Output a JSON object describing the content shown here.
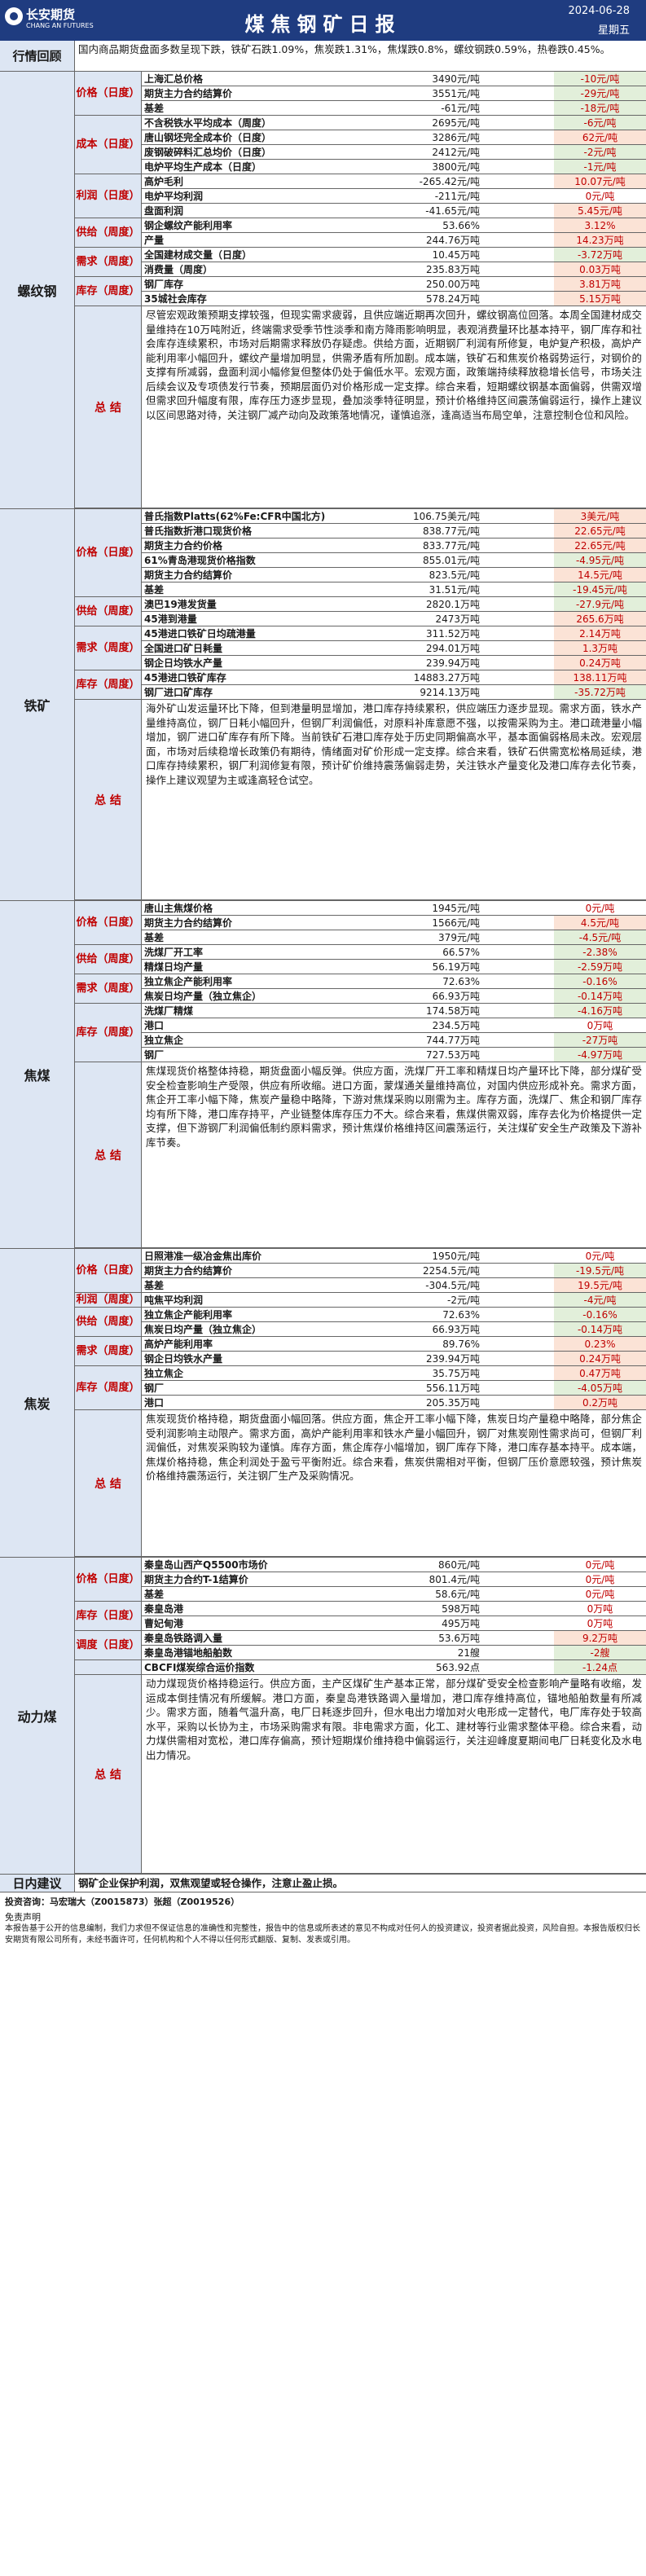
{
  "header": {
    "logo_cn": "长安期货",
    "logo_en": "CHANG AN FUTURES",
    "title": "煤焦钢矿日报",
    "date": "2024-06-28",
    "weekday": "星期五"
  },
  "review": {
    "label": "行情回顾",
    "text": "国内商品期货盘面多数呈现下跌，铁矿石跌1.09%，焦炭跌1.31%，焦煤跌0.8%，螺纹钢跌0.59%，热卷跌0.45%。"
  },
  "sections": [
    {
      "name": "螺纹钢",
      "groups": [
        {
          "label": "价格（日度）",
          "rows": [
            {
              "k": "上海汇总价格",
              "v": "3490元/吨",
              "c": "-10元/吨",
              "s": "dn"
            },
            {
              "k": "期货主力合约结算价",
              "v": "3551元/吨",
              "c": "-29元/吨",
              "s": "dn"
            },
            {
              "k": "基差",
              "v": "-61元/吨",
              "c": "-18元/吨",
              "s": "dn"
            }
          ]
        },
        {
          "label": "成本（日度）",
          "rows": [
            {
              "k": "不含税铁水平均成本（周度）",
              "v": "2695元/吨",
              "c": "-6元/吨",
              "s": "dn"
            },
            {
              "k": "唐山钢坯完全成本价（日度）",
              "v": "3286元/吨",
              "c": "62元/吨",
              "s": "up"
            },
            {
              "k": "废钢破碎料汇总均价（日度）",
              "v": "2412元/吨",
              "c": "-2元/吨",
              "s": "dn"
            },
            {
              "k": "电炉平均生产成本（日度）",
              "v": "3800元/吨",
              "c": "-1元/吨",
              "s": "dn"
            }
          ]
        },
        {
          "label": "利润（日度）",
          "rows": [
            {
              "k": "高炉毛利",
              "v": "-265.42元/吨",
              "c": "10.07元/吨",
              "s": "up"
            },
            {
              "k": "电炉平均利润",
              "v": "-211元/吨",
              "c": "0元/吨",
              "s": ""
            },
            {
              "k": "盘面利润",
              "v": "-41.65元/吨",
              "c": "5.45元/吨",
              "s": "up"
            }
          ]
        },
        {
          "label": "供给（周度）",
          "rows": [
            {
              "k": "钢企螺纹产能利用率",
              "v": "53.66%",
              "c": "3.12%",
              "s": "up"
            },
            {
              "k": "产量",
              "v": "244.76万吨",
              "c": "14.23万吨",
              "s": "up"
            }
          ]
        },
        {
          "label": "需求（周度）",
          "rows": [
            {
              "k": "全国建材成交量（日度）",
              "v": "10.45万吨",
              "c": "-3.72万吨",
              "s": "dn"
            },
            {
              "k": "消费量（周度）",
              "v": "235.83万吨",
              "c": "0.03万吨",
              "s": "up"
            }
          ]
        },
        {
          "label": "库存（周度）",
          "rows": [
            {
              "k": "钢厂库存",
              "v": "250.00万吨",
              "c": "3.81万吨",
              "s": "up"
            },
            {
              "k": "35城社会库存",
              "v": "578.24万吨",
              "c": "5.15万吨",
              "s": "up"
            }
          ]
        }
      ],
      "summary": "尽管宏观政策预期支撑较强，但现实需求疲弱，且供应端近期再次回升，螺纹钢高位回落。本周全国建材成交量维持在10万吨附近，终端需求受季节性淡季和南方降雨影响明显，表观消费量环比基本持平，钢厂库存和社会库存连续累积，市场对后期需求释放仍存疑虑。供给方面，近期钢厂利润有所修复，电炉复产积极，高炉产能利用率小幅回升，螺纹产量增加明显，供需矛盾有所加剧。成本端，铁矿石和焦炭价格弱势运行，对钢价的支撑有所减弱，盘面利润小幅修复但整体仍处于偏低水平。宏观方面，政策端持续释放稳增长信号，市场关注后续会议及专项债发行节奏，预期层面仍对价格形成一定支撑。综合来看，短期螺纹钢基本面偏弱，供需双增但需求回升幅度有限，库存压力逐步显现，叠加淡季特征明显，预计价格维持区间震荡偏弱运行，操作上建议以区间思路对待，关注钢厂减产动向及政策落地情况，谨慎追涨，逢高适当布局空单，注意控制仓位和风险。"
    },
    {
      "name": "铁矿",
      "groups": [
        {
          "label": "价格（日度）",
          "rows": [
            {
              "k": "普氏指数Platts(62%Fe:CFR中国北方)",
              "v": "106.75美元/吨",
              "c": "3美元/吨",
              "s": "up"
            },
            {
              "k": "普氏指数折港口现货价格",
              "v": "838.77元/吨",
              "c": "22.65元/吨",
              "s": "up"
            },
            {
              "k": "期货主力合约价格",
              "v": "833.77元/吨",
              "c": "22.65元/吨",
              "s": "up"
            },
            {
              "k": "61%青岛港现货价格指数",
              "v": "855.01元/吨",
              "c": "-4.95元/吨",
              "s": "dn"
            },
            {
              "k": "期货主力合约结算价",
              "v": "823.5元/吨",
              "c": "14.5元/吨",
              "s": "up"
            },
            {
              "k": "基差",
              "v": "31.51元/吨",
              "c": "-19.45元/吨",
              "s": "dn"
            }
          ]
        },
        {
          "label": "供给（周度）",
          "rows": [
            {
              "k": "澳巴19港发货量",
              "v": "2820.1万吨",
              "c": "-27.9元/吨",
              "s": "dn"
            },
            {
              "k": "45港到港量",
              "v": "2473万吨",
              "c": "265.6万吨",
              "s": "up"
            }
          ]
        },
        {
          "label": "需求（周度）",
          "rows": [
            {
              "k": "45港进口铁矿日均疏港量",
              "v": "311.52万吨",
              "c": "2.14万吨",
              "s": "up"
            },
            {
              "k": "全国进口矿日耗量",
              "v": "294.01万吨",
              "c": "1.3万吨",
              "s": "up"
            },
            {
              "k": "钢企日均铁水产量",
              "v": "239.94万吨",
              "c": "0.24万吨",
              "s": "up"
            }
          ]
        },
        {
          "label": "库存（周度）",
          "rows": [
            {
              "k": "45港进口铁矿库存",
              "v": "14883.27万吨",
              "c": "138.11万吨",
              "s": "up"
            },
            {
              "k": "钢厂进口矿库存",
              "v": "9214.13万吨",
              "c": "-35.72万吨",
              "s": "dn"
            }
          ]
        }
      ],
      "summary": "海外矿山发运量环比下降，但到港量明显增加，港口库存持续累积，供应端压力逐步显现。需求方面，铁水产量维持高位，钢厂日耗小幅回升，但钢厂利润偏低，对原料补库意愿不强，以按需采购为主。港口疏港量小幅增加，钢厂进口矿库存有所下降。当前铁矿石港口库存处于历史同期偏高水平，基本面偏弱格局未改。宏观层面，市场对后续稳增长政策仍有期待，情绪面对矿价形成一定支撑。综合来看，铁矿石供需宽松格局延续，港口库存持续累积，钢厂利润修复有限，预计矿价维持震荡偏弱走势，关注铁水产量变化及港口库存去化节奏，操作上建议观望为主或逢高轻仓试空。"
    },
    {
      "name": "焦煤",
      "groups": [
        {
          "label": "价格（日度）",
          "rows": [
            {
              "k": "唐山主焦煤价格",
              "v": "1945元/吨",
              "c": "0元/吨",
              "s": ""
            },
            {
              "k": "期货主力合约结算价",
              "v": "1566元/吨",
              "c": "4.5元/吨",
              "s": "up"
            },
            {
              "k": "基差",
              "v": "379元/吨",
              "c": "-4.5元/吨",
              "s": "dn"
            }
          ]
        },
        {
          "label": "供给（周度）",
          "rows": [
            {
              "k": "洗煤厂开工率",
              "v": "66.57%",
              "c": "-2.38%",
              "s": "dn"
            },
            {
              "k": "精煤日均产量",
              "v": "56.19万吨",
              "c": "-2.59万吨",
              "s": "dn"
            }
          ]
        },
        {
          "label": "需求（周度）",
          "rows": [
            {
              "k": "独立焦企产能利用率",
              "v": "72.63%",
              "c": "-0.16%",
              "s": "dn"
            },
            {
              "k": "焦炭日均产量（独立焦企）",
              "v": "66.93万吨",
              "c": "-0.14万吨",
              "s": "dn"
            }
          ]
        },
        {
          "label": "库存（周度）",
          "rows": [
            {
              "k": "洗煤厂精煤",
              "v": "174.58万吨",
              "c": "-4.16万吨",
              "s": "dn"
            },
            {
              "k": "港口",
              "v": "234.5万吨",
              "c": "0万吨",
              "s": ""
            },
            {
              "k": "独立焦企",
              "v": "744.77万吨",
              "c": "-27万吨",
              "s": "dn"
            },
            {
              "k": "钢厂",
              "v": "727.53万吨",
              "c": "-4.97万吨",
              "s": "dn"
            }
          ]
        }
      ],
      "summary": "焦煤现货价格整体持稳，期货盘面小幅反弹。供应方面，洗煤厂开工率和精煤日均产量环比下降，部分煤矿受安全检查影响生产受限，供应有所收缩。进口方面，蒙煤通关量维持高位，对国内供应形成补充。需求方面，焦企开工率小幅下降，焦炭产量稳中略降，下游对焦煤采购以刚需为主。库存方面，洗煤厂、焦企和钢厂库存均有所下降，港口库存持平，产业链整体库存压力不大。综合来看，焦煤供需双弱，库存去化为价格提供一定支撑，但下游钢厂利润偏低制约原料需求，预计焦煤价格维持区间震荡运行，关注煤矿安全生产政策及下游补库节奏。"
    },
    {
      "name": "焦炭",
      "groups": [
        {
          "label": "价格（日度）",
          "rows": [
            {
              "k": "日照港准一级冶金焦出库价",
              "v": "1950元/吨",
              "c": "0元/吨",
              "s": ""
            },
            {
              "k": "期货主力合约结算价",
              "v": "2254.5元/吨",
              "c": "-19.5元/吨",
              "s": "dn"
            },
            {
              "k": "基差",
              "v": "-304.5元/吨",
              "c": "19.5元/吨",
              "s": "up"
            }
          ]
        },
        {
          "label": "利润（周度）",
          "rows": [
            {
              "k": "吨焦平均利润",
              "v": "-2元/吨",
              "c": "-4元/吨",
              "s": "dn"
            }
          ]
        },
        {
          "label": "供给（周度）",
          "rows": [
            {
              "k": "独立焦企产能利用率",
              "v": "72.63%",
              "c": "-0.16%",
              "s": "dn"
            },
            {
              "k": "焦炭日均产量（独立焦企）",
              "v": "66.93万吨",
              "c": "-0.14万吨",
              "s": "dn"
            }
          ]
        },
        {
          "label": "需求（周度）",
          "rows": [
            {
              "k": "高炉产能利用率",
              "v": "89.76%",
              "c": "0.23%",
              "s": "up"
            },
            {
              "k": "钢企日均铁水产量",
              "v": "239.94万吨",
              "c": "0.24万吨",
              "s": "up"
            }
          ]
        },
        {
          "label": "库存（周度）",
          "rows": [
            {
              "k": "独立焦企",
              "v": "35.75万吨",
              "c": "0.47万吨",
              "s": "up"
            },
            {
              "k": "钢厂",
              "v": "556.11万吨",
              "c": "-4.05万吨",
              "s": "dn"
            },
            {
              "k": "港口",
              "v": "205.35万吨",
              "c": "0.2万吨",
              "s": "up"
            }
          ]
        }
      ],
      "summary": "焦炭现货价格持稳，期货盘面小幅回落。供应方面，焦企开工率小幅下降，焦炭日均产量稳中略降，部分焦企受利润影响主动限产。需求方面，高炉产能利用率和铁水产量小幅回升，钢厂对焦炭刚性需求尚可，但钢厂利润偏低，对焦炭采购较为谨慎。库存方面，焦企库存小幅增加，钢厂库存下降，港口库存基本持平。成本端，焦煤价格持稳，焦企利润处于盈亏平衡附近。综合来看，焦炭供需相对平衡，但钢厂压价意愿较强，预计焦炭价格维持震荡运行，关注钢厂生产及采购情况。"
    },
    {
      "name": "动力煤",
      "groups": [
        {
          "label": "价格（日度）",
          "rows": [
            {
              "k": "秦皇岛山西产Q5500市场价",
              "v": "860元/吨",
              "c": "0元/吨",
              "s": ""
            },
            {
              "k": "期货主力合约T-1结算价",
              "v": "801.4元/吨",
              "c": "0元/吨",
              "s": ""
            },
            {
              "k": "基差",
              "v": "58.6元/吨",
              "c": "0元/吨",
              "s": ""
            }
          ]
        },
        {
          "label": "库存（日度）",
          "rows": [
            {
              "k": "秦皇岛港",
              "v": "598万吨",
              "c": "0万吨",
              "s": ""
            },
            {
              "k": "曹妃甸港",
              "v": "495万吨",
              "c": "0万吨",
              "s": ""
            }
          ]
        },
        {
          "label": "调度（日度）",
          "rows": [
            {
              "k": "秦皇岛铁路调入量",
              "v": "53.6万吨",
              "c": "9.2万吨",
              "s": "up"
            },
            {
              "k": "秦皇岛港锚地船舶数",
              "v": "21艘",
              "c": "-2艘",
              "s": "dn"
            }
          ]
        },
        {
          "label": "",
          "rows": [
            {
              "k": "CBCFI煤炭综合运价指数",
              "v": "563.92点",
              "c": "-1.24点",
              "s": "dn"
            }
          ]
        }
      ],
      "summary": "动力煤现货价格持稳运行。供应方面，主产区煤矿生产基本正常，部分煤矿受安全检查影响产量略有收缩，发运成本倒挂情况有所缓解。港口方面，秦皇岛港铁路调入量增加，港口库存维持高位，锚地船舶数量有所减少。需求方面，随着气温升高，电厂日耗逐步回升，但水电出力增加对火电形成一定替代，电厂库存处于较高水平，采购以长协为主，市场采购需求有限。非电需求方面，化工、建材等行业需求整体平稳。综合来看，动力煤供需相对宽松，港口库存偏高，预计短期煤价维持稳中偏弱运行，关注迎峰度夏期间电厂日耗变化及水电出力情况。"
    }
  ],
  "advice": {
    "label": "日内建议",
    "text": "钢矿企业保护利润，双焦观望或轻仓操作，注意止盈止损。"
  },
  "footer": {
    "analyst_line": "投资咨询：马宏瑞大（Z0015873）张超（Z0019526）",
    "disclaimer_title": "免责声明",
    "disclaimer": "本报告基于公开的信息编制，我们力求但不保证信息的准确性和完整性，报告中的信息或所表述的意见不构成对任何人的投资建议，投资者据此投资，风险自担。本报告版权归长安期货有限公司所有，未经书面许可，任何机构和个人不得以任何形式翻版、复制、发表或引用。"
  }
}
